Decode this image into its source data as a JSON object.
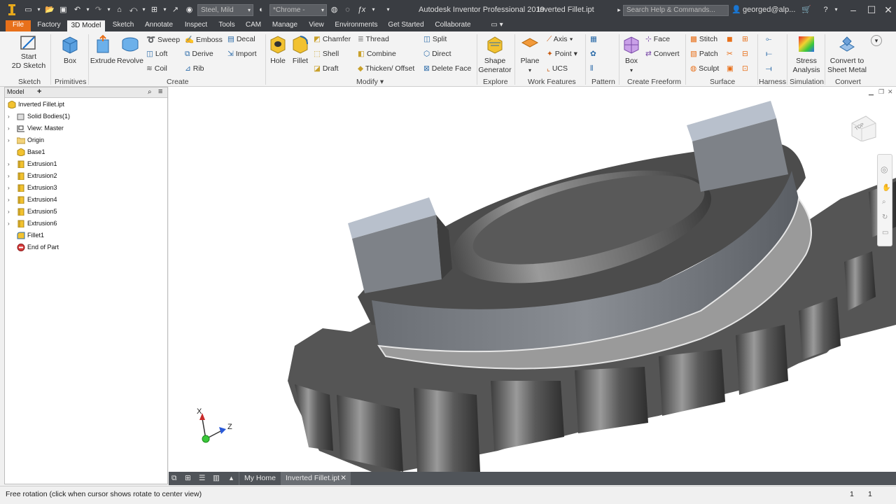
{
  "app": {
    "title": "Autodesk Inventor Professional 2019",
    "document": "Inverted Fillet.ipt"
  },
  "quick_access": {
    "material": "Steel, Mild",
    "appearance": "*Chrome -",
    "search_placeholder": "Search Help & Commands...",
    "user": "georged@alp..."
  },
  "tabs": [
    "File",
    "Factory",
    "3D Model",
    "Sketch",
    "Annotate",
    "Inspect",
    "Tools",
    "CAM",
    "Manage",
    "View",
    "Environments",
    "Get Started",
    "Collaborate"
  ],
  "active_tab": "3D Model",
  "ribbon": {
    "sketch": {
      "start_label": "Start",
      "sketch_label": "2D Sketch",
      "panel": "Sketch"
    },
    "primitives": {
      "box": "Box",
      "panel": "Primitives"
    },
    "create": {
      "extrude": "Extrude",
      "revolve": "Revolve",
      "sweep": "Sweep",
      "loft": "Loft",
      "coil": "Coil",
      "emboss": "Emboss",
      "derive": "Derive",
      "rib": "Rib",
      "decal": "Decal",
      "import": "Import",
      "panel": "Create"
    },
    "modify": {
      "hole": "Hole",
      "fillet": "Fillet",
      "chamfer": "Chamfer",
      "shell": "Shell",
      "draft": "Draft",
      "thread": "Thread",
      "combine": "Combine",
      "thicken": "Thicken/ Offset",
      "split": "Split",
      "direct": "Direct",
      "delete_face": "Delete Face",
      "panel": "Modify"
    },
    "explore": {
      "shape1": "Shape",
      "shape2": "Generator",
      "panel": "Explore"
    },
    "work_features": {
      "plane": "Plane",
      "axis": "Axis",
      "point": "Point",
      "ucs": "UCS",
      "panel": "Work Features"
    },
    "pattern": {
      "panel": "Pattern"
    },
    "freeform": {
      "box": "Box",
      "face": "Face",
      "convert": "Convert",
      "panel": "Create Freeform"
    },
    "surface": {
      "stitch": "Stitch",
      "patch": "Patch",
      "sculpt": "Sculpt",
      "panel": "Surface"
    },
    "harness": {
      "panel": "Harness"
    },
    "simulation": {
      "stress1": "Stress",
      "stress2": "Analysis",
      "panel": "Simulation"
    },
    "convert": {
      "c1": "Convert to",
      "c2": "Sheet Metal",
      "panel": "Convert"
    }
  },
  "browser": {
    "tab": "Model",
    "add": "+",
    "items": [
      {
        "label": "Inverted Fillet.ipt",
        "icon": "part-icon"
      },
      {
        "label": "Solid Bodies(1)",
        "icon": "solid-bodies-icon"
      },
      {
        "label": "View: Master",
        "icon": "view-icon"
      },
      {
        "label": "Origin",
        "icon": "folder-icon"
      },
      {
        "label": "Base1",
        "icon": "base-icon"
      },
      {
        "label": "Extrusion1",
        "icon": "extrusion-icon"
      },
      {
        "label": "Extrusion2",
        "icon": "extrusion-icon"
      },
      {
        "label": "Extrusion3",
        "icon": "extrusion-icon"
      },
      {
        "label": "Extrusion4",
        "icon": "extrusion-icon"
      },
      {
        "label": "Extrusion5",
        "icon": "extrusion-icon"
      },
      {
        "label": "Extrusion6",
        "icon": "extrusion-icon"
      },
      {
        "label": "Fillet1",
        "icon": "fillet-icon"
      },
      {
        "label": "End of Part",
        "icon": "end-of-part-icon"
      }
    ]
  },
  "viewcube": {
    "face": "TOP"
  },
  "triad": {
    "x": "X",
    "z": "Z"
  },
  "doc_tabs": {
    "home": "My Home",
    "active": "Inverted Fillet.ipt",
    "close": "✕"
  },
  "status": {
    "text": "Free rotation (click when cursor shows rotate to center view)",
    "count1": "1",
    "count2": "1"
  },
  "colors": {
    "file_tab": "#e8701a",
    "titlebar": "#3a3d42",
    "part": "#5a5a5a"
  }
}
